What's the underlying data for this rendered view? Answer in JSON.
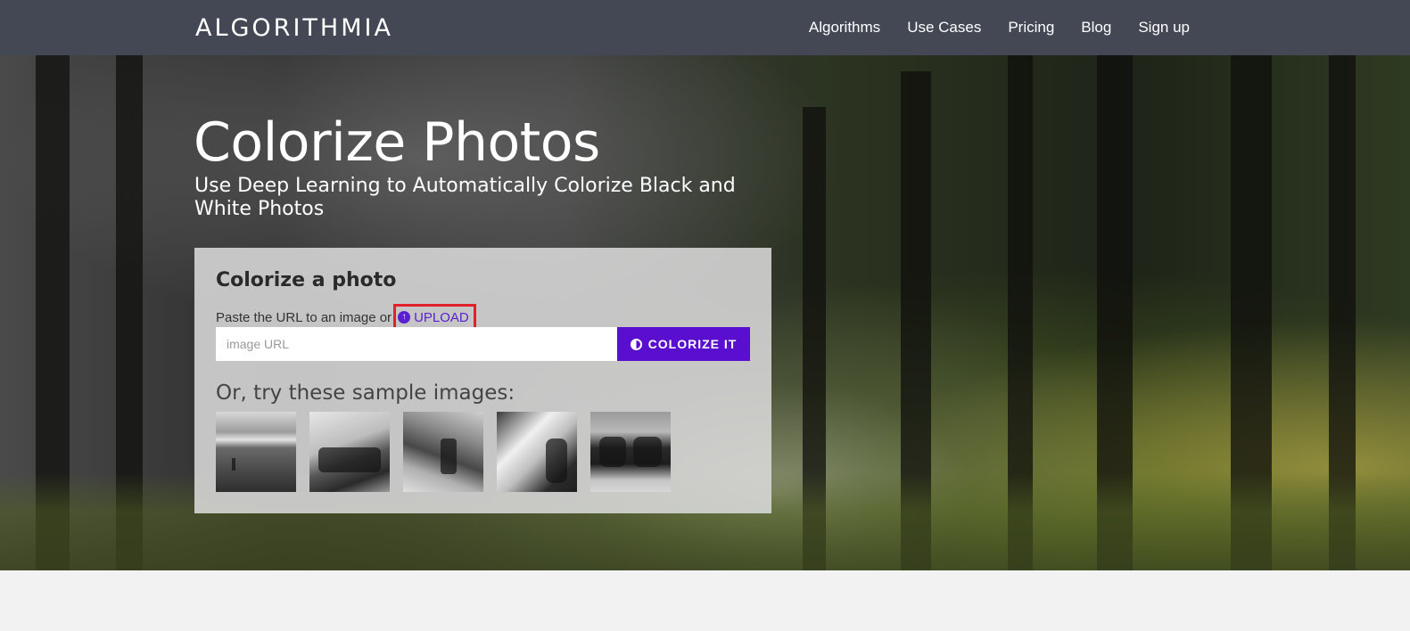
{
  "brand": {
    "name": "ALGORITHMIA"
  },
  "nav": {
    "items": [
      {
        "label": "Algorithms"
      },
      {
        "label": "Use Cases"
      },
      {
        "label": "Pricing"
      },
      {
        "label": "Blog"
      },
      {
        "label": "Sign up"
      }
    ]
  },
  "hero": {
    "title": "Colorize Photos",
    "subtitle": "Use Deep Learning to Automatically Colorize Black and White Photos"
  },
  "card": {
    "title": "Colorize a photo",
    "paste_text": "Paste the URL to an image or",
    "upload_label": "UPLOAD",
    "url_placeholder": "image URL",
    "url_value": "",
    "colorize_label": "COLORIZE IT",
    "samples_title": "Or, try these sample images:",
    "samples": [
      {
        "icon": "sample-bird-water"
      },
      {
        "icon": "sample-race-car"
      },
      {
        "icon": "sample-mountain-person"
      },
      {
        "icon": "sample-fire-breather"
      },
      {
        "icon": "sample-cows"
      }
    ]
  },
  "colors": {
    "navbar": "#434854",
    "accent": "#5a0fd0",
    "upload_highlight": "#e0202a"
  }
}
